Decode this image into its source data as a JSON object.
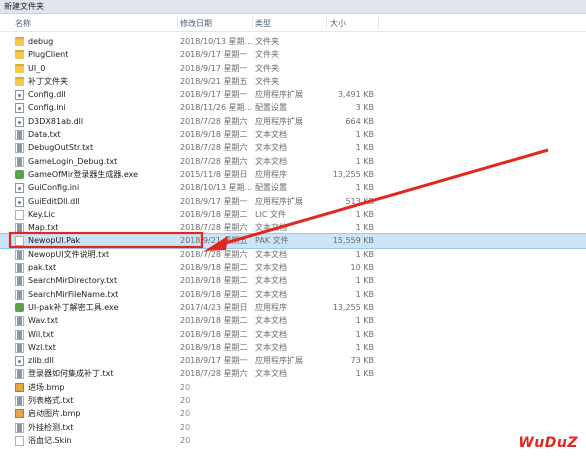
{
  "window": {
    "title": "新建文件夹"
  },
  "columns": {
    "name": "名称",
    "date": "修改日期",
    "type": "类型",
    "size": "大小"
  },
  "files": [
    {
      "name": "debug",
      "date": "2018/10/13 星期...",
      "type": "文件夹",
      "size": "",
      "icon": "folder-icon"
    },
    {
      "name": "PlugClient",
      "date": "2018/9/17 星期一",
      "type": "文件夹",
      "size": "",
      "icon": "folder-icon"
    },
    {
      "name": "UI_0",
      "date": "2018/9/17 星期一",
      "type": "文件夹",
      "size": "",
      "icon": "folder-icon"
    },
    {
      "name": "补丁文件夹",
      "date": "2018/9/21 星期五",
      "type": "文件夹",
      "size": "",
      "icon": "folder-icon"
    },
    {
      "name": "Config.dll",
      "date": "2018/9/17 星期一",
      "type": "应用程序扩展",
      "size": "3,491 KB",
      "icon": "dll-icon"
    },
    {
      "name": "Config.ini",
      "date": "2018/11/26 星期...",
      "type": "配置设置",
      "size": "3 KB",
      "icon": "ini-icon"
    },
    {
      "name": "D3DX81ab.dll",
      "date": "2018/7/28 星期六",
      "type": "应用程序扩展",
      "size": "664 KB",
      "icon": "dll-icon"
    },
    {
      "name": "Data.txt",
      "date": "2018/9/18 星期二",
      "type": "文本文档",
      "size": "1 KB",
      "icon": "txt-icon"
    },
    {
      "name": "DebugOutStr.txt",
      "date": "2018/7/28 星期六",
      "type": "文本文档",
      "size": "1 KB",
      "icon": "txt-icon"
    },
    {
      "name": "GameLogin_Debug.txt",
      "date": "2018/7/28 星期六",
      "type": "文本文档",
      "size": "1 KB",
      "icon": "txt-icon"
    },
    {
      "name": "GameOfMir登录器生成器.exe",
      "date": "2015/11/8 星期日",
      "type": "应用程序",
      "size": "13,255 KB",
      "icon": "exe-icon"
    },
    {
      "name": "GuiConfig.ini",
      "date": "2018/10/13 星期...",
      "type": "配置设置",
      "size": "1 KB",
      "icon": "ini-icon"
    },
    {
      "name": "GuiEditDll.dll",
      "date": "2018/9/17 星期一",
      "type": "应用程序扩展",
      "size": "513 KB",
      "icon": "dll-icon"
    },
    {
      "name": "Key.Lic",
      "date": "2018/9/18 星期二",
      "type": "LIC 文件",
      "size": "1 KB",
      "icon": "file-icon"
    },
    {
      "name": "Map.txt",
      "date": "2018/7/28 星期六",
      "type": "文本文档",
      "size": "1 KB",
      "icon": "txt-icon"
    },
    {
      "name": "NewopUI.Pak",
      "date": "2018/9/21 星期五",
      "type": "PAK 文件",
      "size": "15,559 KB",
      "icon": "file-icon",
      "selected": true
    },
    {
      "name": "NewopUI文件说明.txt",
      "date": "2018/7/28 星期六",
      "type": "文本文档",
      "size": "1 KB",
      "icon": "txt-icon"
    },
    {
      "name": "pak.txt",
      "date": "2018/9/18 星期二",
      "type": "文本文档",
      "size": "10 KB",
      "icon": "txt-icon"
    },
    {
      "name": "SearchMirDirectory.txt",
      "date": "2018/9/18 星期二",
      "type": "文本文档",
      "size": "1 KB",
      "icon": "txt-icon"
    },
    {
      "name": "SearchMirFileName.txt",
      "date": "2018/9/18 星期二",
      "type": "文本文档",
      "size": "1 KB",
      "icon": "txt-icon"
    },
    {
      "name": "UI-pak补丁解密工具.exe",
      "date": "2017/4/23 星期日",
      "type": "应用程序",
      "size": "13,255 KB",
      "icon": "exe-icon"
    },
    {
      "name": "Wav.txt",
      "date": "2018/9/18 星期二",
      "type": "文本文档",
      "size": "1 KB",
      "icon": "txt-icon"
    },
    {
      "name": "Wil.txt",
      "date": "2018/9/18 星期二",
      "type": "文本文档",
      "size": "1 KB",
      "icon": "txt-icon"
    },
    {
      "name": "Wzl.txt",
      "date": "2018/9/18 星期二",
      "type": "文本文档",
      "size": "1 KB",
      "icon": "txt-icon"
    },
    {
      "name": "zlib.dll",
      "date": "2018/9/17 星期一",
      "type": "应用程序扩展",
      "size": "73 KB",
      "icon": "dll-icon"
    },
    {
      "name": "登录器如何集成补丁.txt",
      "date": "2018/7/28 星期六",
      "type": "文本文档",
      "size": "1 KB",
      "icon": "txt-icon"
    },
    {
      "name": "进场.bmp",
      "date": "20",
      "type": "",
      "size": "",
      "icon": "image-icon"
    },
    {
      "name": "列表格式.txt",
      "date": "20",
      "type": "",
      "size": "",
      "icon": "txt-icon"
    },
    {
      "name": "启动图片.bmp",
      "date": "20",
      "type": "",
      "size": "",
      "icon": "image-icon"
    },
    {
      "name": "外挂检测.txt",
      "date": "20",
      "type": "",
      "size": "",
      "icon": "txt-icon"
    },
    {
      "name": "浴血记.Skin",
      "date": "20",
      "type": "",
      "size": "",
      "icon": "file-icon"
    }
  ],
  "watermark": "WuDuZ",
  "colors": {
    "selection": "#cce4f7",
    "highlight": "#e3261e",
    "header_text": "#4c607a"
  }
}
